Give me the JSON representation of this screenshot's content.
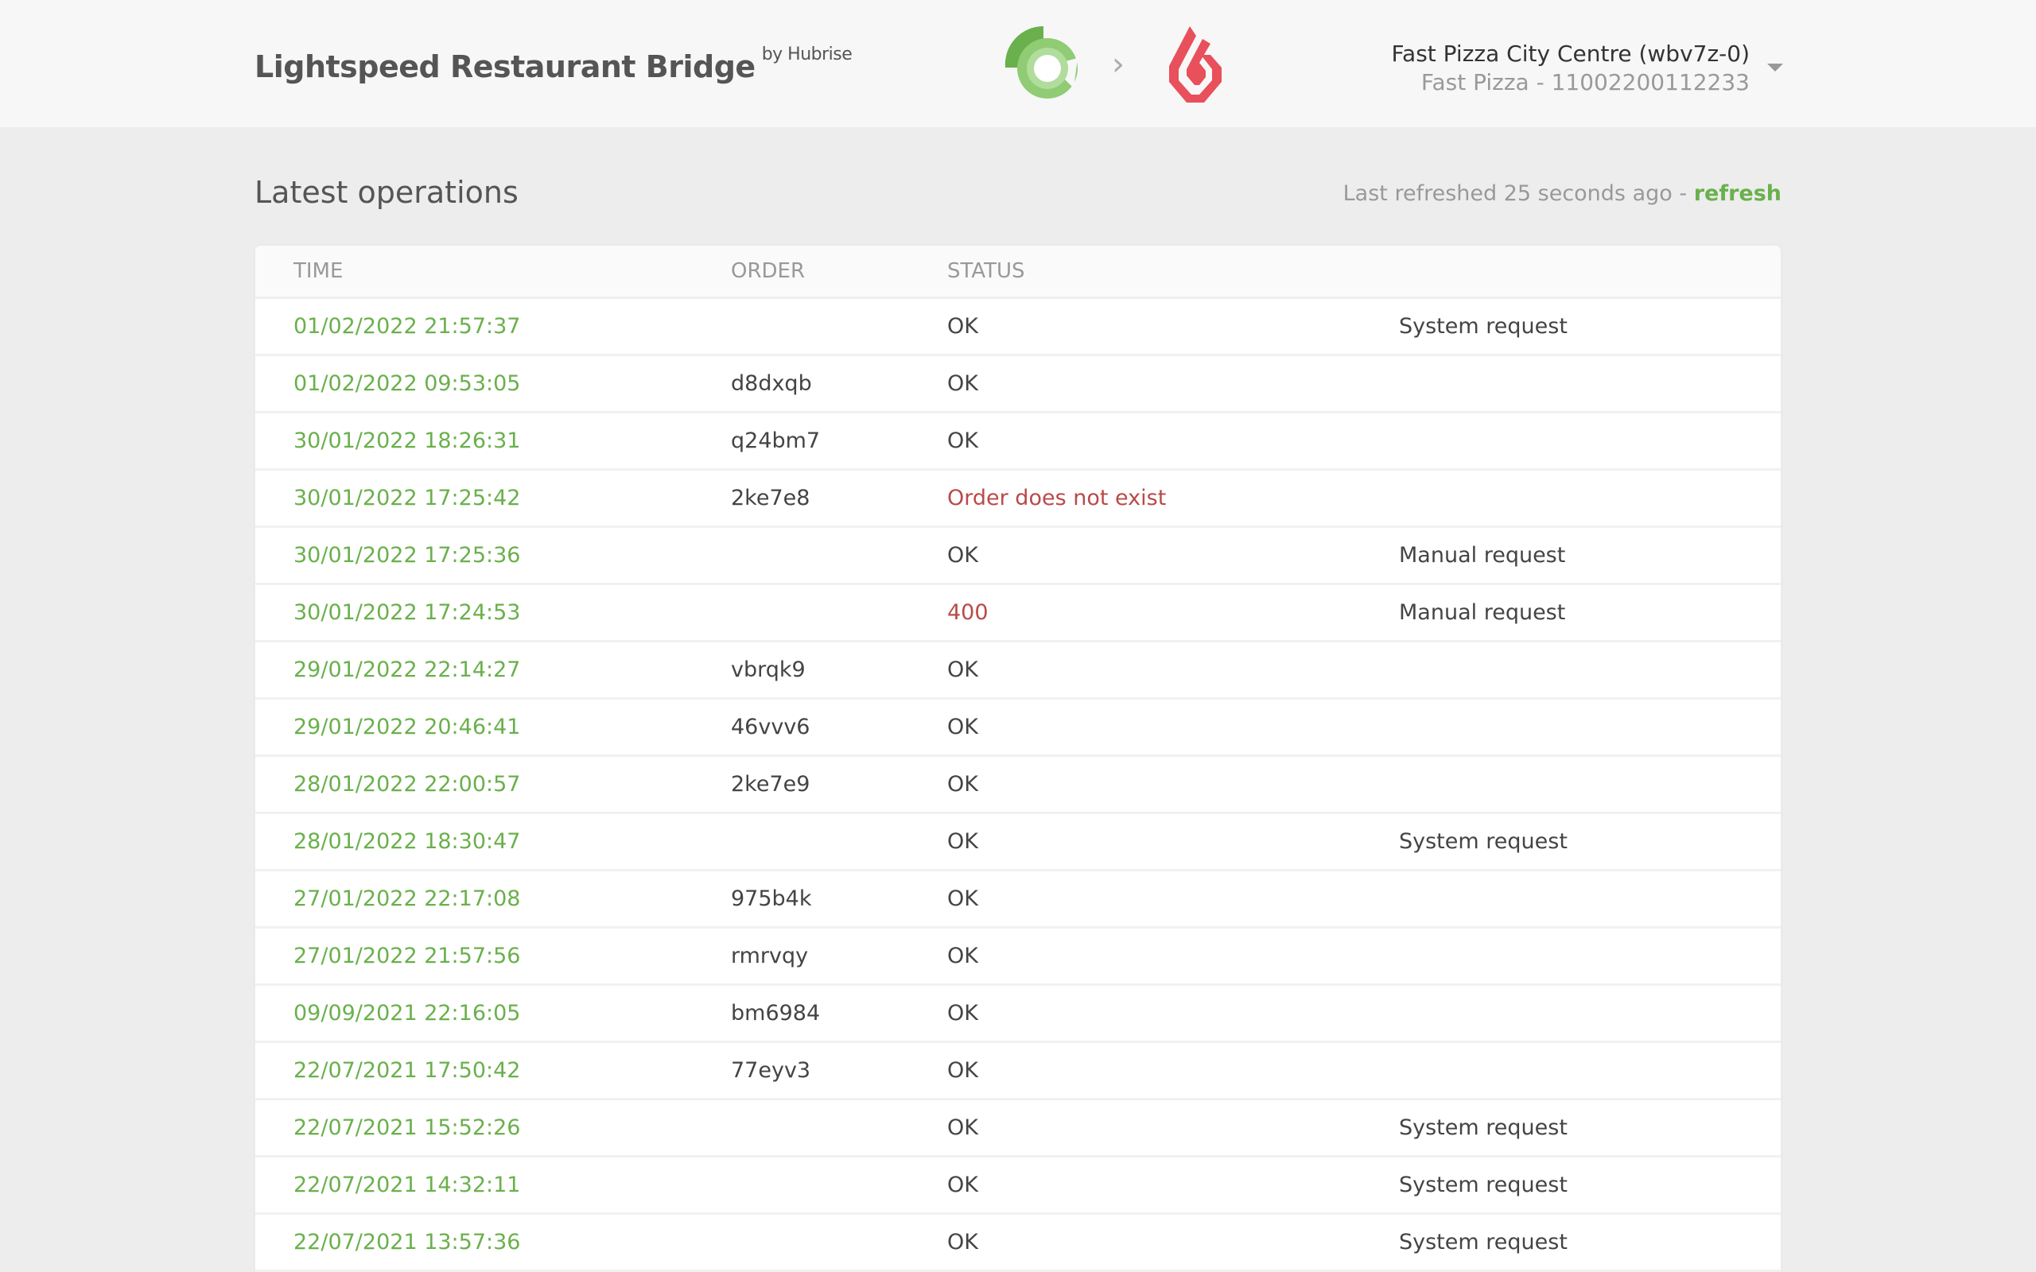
{
  "header": {
    "title": "Lightspeed Restaurant Bridge",
    "by": "by Hubrise",
    "logo_left": "hubrise-logo",
    "logo_right": "lightspeed-logo",
    "arrow": "›",
    "account_name": "Fast Pizza City Centre (wbv7z-0)",
    "account_sub": "Fast Pizza - 11002200112233"
  },
  "main": {
    "title": "Latest operations",
    "refreshed_text": "Last refreshed 25 seconds ago - ",
    "refresh_link": "refresh"
  },
  "table": {
    "columns": [
      "TIME",
      "ORDER",
      "STATUS",
      ""
    ],
    "rows": [
      {
        "time": "01/02/2022 21:57:37",
        "order": "",
        "status": "OK",
        "error": false,
        "note": "System request"
      },
      {
        "time": "01/02/2022 09:53:05",
        "order": "d8dxqb",
        "status": "OK",
        "error": false,
        "note": ""
      },
      {
        "time": "30/01/2022 18:26:31",
        "order": "q24bm7",
        "status": "OK",
        "error": false,
        "note": ""
      },
      {
        "time": "30/01/2022 17:25:42",
        "order": "2ke7e8",
        "status": "Order does not exist",
        "error": true,
        "note": ""
      },
      {
        "time": "30/01/2022 17:25:36",
        "order": "",
        "status": "OK",
        "error": false,
        "note": "Manual request"
      },
      {
        "time": "30/01/2022 17:24:53",
        "order": "",
        "status": "400",
        "error": true,
        "note": "Manual request"
      },
      {
        "time": "29/01/2022 22:14:27",
        "order": "vbrqk9",
        "status": "OK",
        "error": false,
        "note": ""
      },
      {
        "time": "29/01/2022 20:46:41",
        "order": "46vvv6",
        "status": "OK",
        "error": false,
        "note": ""
      },
      {
        "time": "28/01/2022 22:00:57",
        "order": "2ke7e9",
        "status": "OK",
        "error": false,
        "note": ""
      },
      {
        "time": "28/01/2022 18:30:47",
        "order": "",
        "status": "OK",
        "error": false,
        "note": "System request"
      },
      {
        "time": "27/01/2022 22:17:08",
        "order": "975b4k",
        "status": "OK",
        "error": false,
        "note": ""
      },
      {
        "time": "27/01/2022 21:57:56",
        "order": "rmrvqy",
        "status": "OK",
        "error": false,
        "note": ""
      },
      {
        "time": "09/09/2021 22:16:05",
        "order": "bm6984",
        "status": "OK",
        "error": false,
        "note": ""
      },
      {
        "time": "22/07/2021 17:50:42",
        "order": "77eyv3",
        "status": "OK",
        "error": false,
        "note": ""
      },
      {
        "time": "22/07/2021 15:52:26",
        "order": "",
        "status": "OK",
        "error": false,
        "note": "System request"
      },
      {
        "time": "22/07/2021 14:32:11",
        "order": "",
        "status": "OK",
        "error": false,
        "note": "System request"
      },
      {
        "time": "22/07/2021 13:57:36",
        "order": "",
        "status": "OK",
        "error": false,
        "note": "System request"
      }
    ]
  },
  "colors": {
    "accent_green": "#6ab04c",
    "error_red": "#b94a48",
    "lightspeed_red": "#e8505b"
  }
}
